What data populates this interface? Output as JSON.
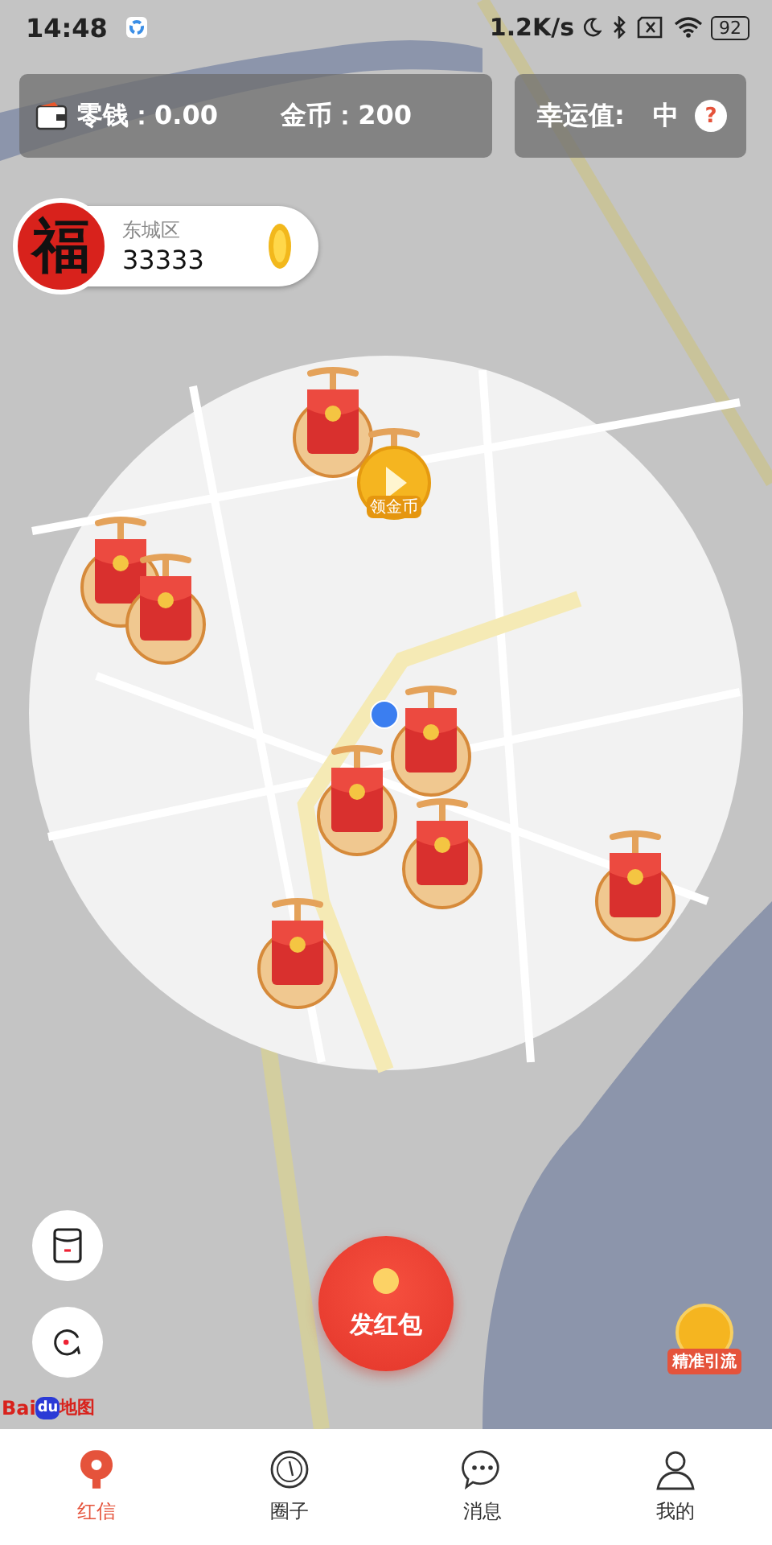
{
  "status_bar": {
    "time": "14:48",
    "speed": "1.2K/s",
    "battery": "92"
  },
  "wallet": {
    "change_label": "零钱：",
    "change_value": "0.00",
    "coins_label": "金币：",
    "coins_value": "200"
  },
  "luck": {
    "label": "幸运值:",
    "value": "中",
    "help": "?"
  },
  "user": {
    "avatar_char": "福",
    "district": "东城区",
    "amount": "33333"
  },
  "map": {
    "markers": [
      {
        "kind": "packet"
      },
      {
        "kind": "coin",
        "label": "领金币"
      },
      {
        "kind": "packet"
      },
      {
        "kind": "packet"
      },
      {
        "kind": "packet"
      },
      {
        "kind": "packet"
      },
      {
        "kind": "packet"
      },
      {
        "kind": "packet"
      },
      {
        "kind": "packet"
      }
    ],
    "logo": {
      "part1": "Bai",
      "part2": "du",
      "part3": "地图"
    }
  },
  "send_button": {
    "label": "发红包"
  },
  "promo": {
    "label": "精准引流"
  },
  "nav": [
    {
      "label": "红信",
      "selected": true
    },
    {
      "label": "圈子",
      "selected": false
    },
    {
      "label": "消息",
      "selected": false
    },
    {
      "label": "我的",
      "selected": false
    }
  ]
}
